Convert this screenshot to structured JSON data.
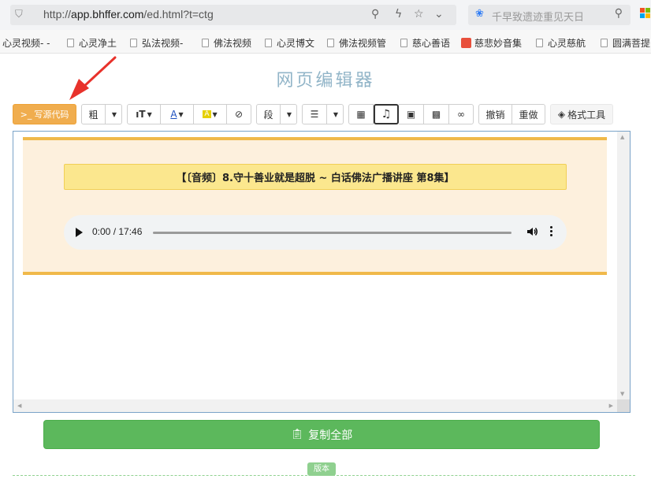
{
  "browser": {
    "url_prefix": "http://",
    "url_host": "app.bhffer.com",
    "url_path": "/ed.html?t=ctg",
    "search_placeholder": "千早致遗迹重见天日"
  },
  "bookmarks": [
    "心灵视频- -",
    "心灵净土",
    "弘法视频-",
    "佛法视频",
    "心灵博文",
    "佛法视频管",
    "慈心善语",
    "慈悲妙音集",
    "心灵慈航",
    "圆满菩提"
  ],
  "page": {
    "title": "网页编辑器"
  },
  "toolbar": {
    "source_label": "写源代码",
    "bold_label": "粗",
    "paragraph_label": "段",
    "undo_label": "撤销",
    "redo_label": "重做",
    "format_tools_label": "格式工具"
  },
  "editor": {
    "banner_text": "【〔音频〕8.守十善业就是超脱 ~ 白话佛法广播讲座 第8集】",
    "audio_time": "0:00 / 17:46"
  },
  "footer": {
    "copy_all_label": "复制全部",
    "version_label": "版本"
  },
  "colors": {
    "source_button": "#f0ad4e",
    "copy_button": "#5cb85c",
    "content_border": "#f0b94a",
    "content_bg": "#fdf0dd",
    "banner_bg": "#fbe78e",
    "title": "#92b5c8",
    "arrow": "#e8322b"
  }
}
